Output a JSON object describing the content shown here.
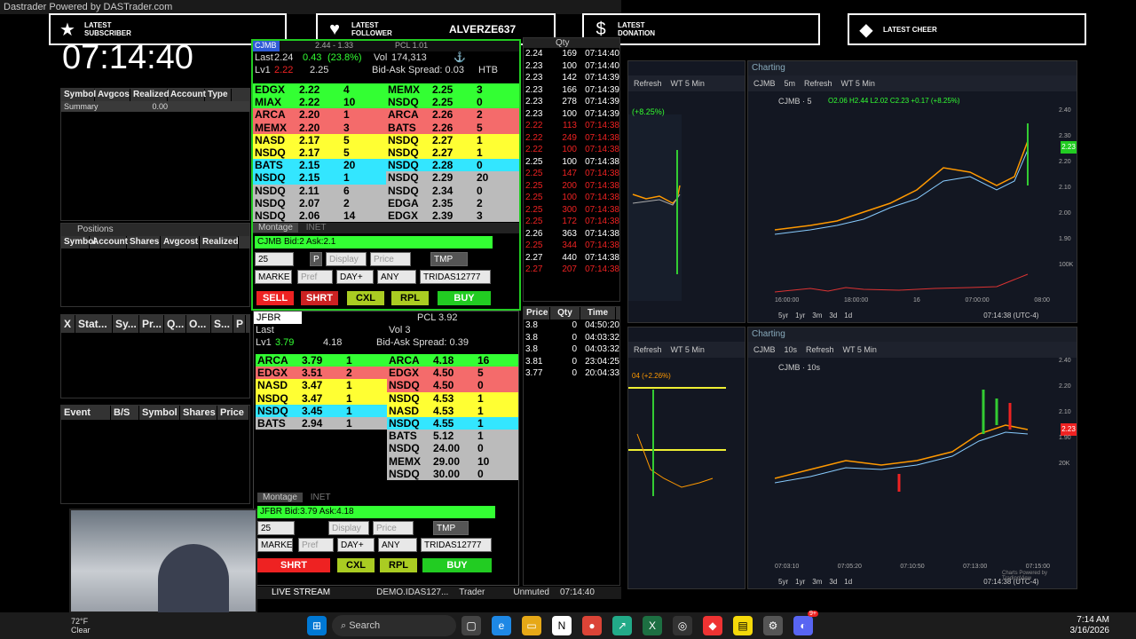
{
  "app_title": "Dastrader Powered by DASTrader.com",
  "clock": "07:14:40",
  "banners": [
    {
      "icon": "★",
      "label": "LATEST SUBSCRIBER",
      "value": ""
    },
    {
      "icon": "♥",
      "label": "LATEST FOLLOWER",
      "value": "ALVERZE637"
    },
    {
      "icon": "$",
      "label": "LATEST DONATION",
      "value": ""
    },
    {
      "icon": "◆",
      "label": "LATEST CHEER",
      "value": ""
    }
  ],
  "account_panel": {
    "columns": [
      "Symbol",
      "Avgcos",
      "Realized",
      "Account",
      "Type"
    ],
    "row": {
      "symbol": "Summary",
      "realized": "0.00"
    }
  },
  "positions_panel": {
    "title": "Positions",
    "columns": [
      "Symbol",
      "Account",
      "Shares",
      "Avgcost",
      "Realized"
    ]
  },
  "orders_panel": {
    "columns": [
      "X",
      "Stat...",
      "Sy...",
      "Pr...",
      "Q...",
      "O...",
      "S...",
      "P"
    ]
  },
  "trades_panel": {
    "columns": [
      "Event",
      "B/S",
      "Symbol",
      "Shares",
      "Price"
    ]
  },
  "montage1": {
    "symbol": "CJMB",
    "change_line": "2.44 - 1.33",
    "pcl": "PCL 1.01",
    "last": "2.24",
    "chg": "0.43",
    "chg_pct": "(23.8%)",
    "vol": "174,313",
    "htb": "HTB",
    "lv1_bid": "2.22",
    "lv1_ask": "2.25",
    "spread": "Bid-Ask Spread: 0.03",
    "bids": [
      {
        "ex": "EDGX",
        "px": "2.22",
        "sz": "4",
        "c": "green"
      },
      {
        "ex": "MIAX",
        "px": "2.22",
        "sz": "10",
        "c": "green"
      },
      {
        "ex": "ARCA",
        "px": "2.20",
        "sz": "1",
        "c": "red"
      },
      {
        "ex": "MEMX",
        "px": "2.20",
        "sz": "3",
        "c": "red"
      },
      {
        "ex": "NASD",
        "px": "2.17",
        "sz": "5",
        "c": "yellow"
      },
      {
        "ex": "NSDQ",
        "px": "2.17",
        "sz": "5",
        "c": "yellow"
      },
      {
        "ex": "BATS",
        "px": "2.15",
        "sz": "20",
        "c": "cyan"
      },
      {
        "ex": "NSDQ",
        "px": "2.15",
        "sz": "1",
        "c": "cyan"
      },
      {
        "ex": "NSDQ",
        "px": "2.11",
        "sz": "6",
        "c": "gray"
      },
      {
        "ex": "NSDQ",
        "px": "2.07",
        "sz": "2",
        "c": "gray"
      },
      {
        "ex": "NSDQ",
        "px": "2.06",
        "sz": "14",
        "c": "gray"
      }
    ],
    "asks": [
      {
        "ex": "MEMX",
        "px": "2.25",
        "sz": "3",
        "c": "green"
      },
      {
        "ex": "NSDQ",
        "px": "2.25",
        "sz": "0",
        "c": "green"
      },
      {
        "ex": "ARCA",
        "px": "2.26",
        "sz": "2",
        "c": "red"
      },
      {
        "ex": "BATS",
        "px": "2.26",
        "sz": "5",
        "c": "red"
      },
      {
        "ex": "NSDQ",
        "px": "2.27",
        "sz": "1",
        "c": "yellow"
      },
      {
        "ex": "NSDQ",
        "px": "2.27",
        "sz": "1",
        "c": "yellow"
      },
      {
        "ex": "NSDQ",
        "px": "2.28",
        "sz": "0",
        "c": "cyan"
      },
      {
        "ex": "NSDQ",
        "px": "2.29",
        "sz": "20",
        "c": "gray"
      },
      {
        "ex": "NSDQ",
        "px": "2.34",
        "sz": "0",
        "c": "gray"
      },
      {
        "ex": "EDGA",
        "px": "2.35",
        "sz": "2",
        "c": "gray"
      },
      {
        "ex": "EDGX",
        "px": "2.39",
        "sz": "3",
        "c": "gray"
      }
    ],
    "tab": "Montage",
    "tab2": "INET",
    "quote": "CJMB Bid:2 Ask:2.1",
    "qty": "25",
    "p": "P",
    "display": "Display",
    "price": "Price",
    "tmp": "TMP",
    "market": "MARKE",
    "pref": "Pref",
    "tif": "DAY+",
    "any": "ANY",
    "route": "TRIDAS12777",
    "buttons": {
      "sell": "SELL",
      "shrt": "SHRT",
      "cxl": "CXL",
      "rpl": "RPL",
      "buy": "BUY"
    }
  },
  "ts1": {
    "header_qty": "Qty",
    "rows": [
      {
        "p": "2.24",
        "q": "169",
        "t": "07:14:40",
        "c": "#fff"
      },
      {
        "p": "2.23",
        "q": "100",
        "t": "07:14:40",
        "c": "#fff"
      },
      {
        "p": "2.23",
        "q": "142",
        "t": "07:14:39",
        "c": "#fff"
      },
      {
        "p": "2.23",
        "q": "166",
        "t": "07:14:39",
        "c": "#fff"
      },
      {
        "p": "2.23",
        "q": "278",
        "t": "07:14:39",
        "c": "#fff"
      },
      {
        "p": "2.23",
        "q": "100",
        "t": "07:14:39",
        "c": "#fff"
      },
      {
        "p": "2.22",
        "q": "113",
        "t": "07:14:38",
        "c": "#e22"
      },
      {
        "p": "2.22",
        "q": "249",
        "t": "07:14:38",
        "c": "#e22"
      },
      {
        "p": "2.22",
        "q": "100",
        "t": "07:14:38",
        "c": "#e22"
      },
      {
        "p": "2.25",
        "q": "100",
        "t": "07:14:38",
        "c": "#fff"
      },
      {
        "p": "2.25",
        "q": "147",
        "t": "07:14:38",
        "c": "#e22"
      },
      {
        "p": "2.25",
        "q": "200",
        "t": "07:14:38",
        "c": "#e22"
      },
      {
        "p": "2.25",
        "q": "100",
        "t": "07:14:38",
        "c": "#e22"
      },
      {
        "p": "2.25",
        "q": "300",
        "t": "07:14:38",
        "c": "#e22"
      },
      {
        "p": "2.25",
        "q": "172",
        "t": "07:14:38",
        "c": "#e22"
      },
      {
        "p": "2.26",
        "q": "363",
        "t": "07:14:38",
        "c": "#fff"
      },
      {
        "p": "2.25",
        "q": "344",
        "t": "07:14:38",
        "c": "#e22"
      },
      {
        "p": "2.27",
        "q": "440",
        "t": "07:14:38",
        "c": "#fff"
      },
      {
        "p": "2.27",
        "q": "207",
        "t": "07:14:38",
        "c": "#e22"
      }
    ]
  },
  "montage2": {
    "symbol": "JFBR",
    "pcl": "PCL 3.92",
    "last": "Last",
    "vol": "Vol 3",
    "lv1_bid": "3.79",
    "lv1_ask": "4.18",
    "spread": "Bid-Ask Spread: 0.39",
    "bids": [
      {
        "ex": "ARCA",
        "px": "3.79",
        "sz": "1",
        "c": "green"
      },
      {
        "ex": "EDGX",
        "px": "3.51",
        "sz": "2",
        "c": "red"
      },
      {
        "ex": "NASD",
        "px": "3.47",
        "sz": "1",
        "c": "yellow"
      },
      {
        "ex": "NSDQ",
        "px": "3.47",
        "sz": "1",
        "c": "yellow"
      },
      {
        "ex": "NSDQ",
        "px": "3.45",
        "sz": "1",
        "c": "cyan"
      },
      {
        "ex": "BATS",
        "px": "2.94",
        "sz": "1",
        "c": "gray"
      }
    ],
    "asks": [
      {
        "ex": "ARCA",
        "px": "4.18",
        "sz": "16",
        "c": "green"
      },
      {
        "ex": "EDGX",
        "px": "4.50",
        "sz": "5",
        "c": "red"
      },
      {
        "ex": "NSDQ",
        "px": "4.50",
        "sz": "0",
        "c": "red"
      },
      {
        "ex": "NSDQ",
        "px": "4.53",
        "sz": "1",
        "c": "yellow"
      },
      {
        "ex": "NASD",
        "px": "4.53",
        "sz": "1",
        "c": "yellow"
      },
      {
        "ex": "NSDQ",
        "px": "4.55",
        "sz": "1",
        "c": "cyan"
      },
      {
        "ex": "BATS",
        "px": "5.12",
        "sz": "1",
        "c": "gray"
      },
      {
        "ex": "NSDQ",
        "px": "24.00",
        "sz": "0",
        "c": "gray"
      },
      {
        "ex": "MEMX",
        "px": "29.00",
        "sz": "10",
        "c": "gray"
      },
      {
        "ex": "NSDQ",
        "px": "30.00",
        "sz": "0",
        "c": "gray"
      }
    ],
    "tab": "Montage",
    "tab2": "INET",
    "quote": "JFBR Bid:3.79 Ask:4.18",
    "qty": "25",
    "display": "Display",
    "price": "Price",
    "tmp": "TMP",
    "market": "MARKE",
    "pref": "Pref",
    "tif": "DAY+",
    "any": "ANY",
    "route": "TRIDAS12777",
    "buttons": {
      "shrt": "SHRT",
      "cxl": "CXL",
      "rpl": "RPL",
      "buy": "BUY"
    }
  },
  "ts2": {
    "headers": [
      "Price",
      "Qty",
      "Time"
    ],
    "rows": [
      {
        "p": "3.8",
        "q": "0",
        "t": "04:50:20"
      },
      {
        "p": "3.8",
        "q": "0",
        "t": "04:03:32"
      },
      {
        "p": "3.8",
        "q": "0",
        "t": "04:03:32"
      },
      {
        "p": "3.81",
        "q": "0",
        "t": "23:04:25"
      },
      {
        "p": "3.77",
        "q": "0",
        "t": "20:04:33"
      }
    ]
  },
  "statusbar": {
    "live": "LIVE STREAM",
    "account": "DEMO.IDAS127...",
    "role": "Trader",
    "unmuted": "Unmuted",
    "time": "07:14:40"
  },
  "charts": {
    "title": "Charting",
    "refresh": "Refresh",
    "wt": "WT 5 Min",
    "c1": {
      "sym": "CJMB",
      "interval": "5m",
      "ohlc": "O2.06 H2.44 L2.02 C2.23 +0.17 (+8.25%)",
      "label": "CJMB · 5",
      "tag": "2.23",
      "left_pct": "(+8.25%)",
      "left_levels": [
        "2.40",
        "2.30",
        "2.20",
        "2.10",
        "2.00",
        "1.90"
      ],
      "right_levels": [
        "2.40",
        "2.30",
        "2.20",
        "2.10",
        "2.00",
        "1.90",
        "100K"
      ],
      "xlabels": [
        "16:00:00",
        "18:00:00",
        "16",
        "07:00:00",
        "08:00"
      ],
      "left_xlabels": [
        "07:00:00",
        "08:0"
      ]
    },
    "c2": {
      "sym": "CJMB",
      "interval": "10s",
      "label": "CJMB · 10s",
      "tag": "2.23",
      "left_pct": "04 (+2.26%)",
      "left_levels": [
        "6.00",
        "5.61",
        "5.00",
        "4.00",
        "3.13",
        "3.00",
        "2.00",
        "1.00",
        "200M",
        "100M"
      ],
      "right_levels": [
        "2.40",
        "2.20",
        "2.10",
        "1.90",
        "20K"
      ],
      "xlabels": [
        "07:03:10",
        "07:05:20",
        "07:10:50",
        "07:13:00",
        "07:15:00"
      ],
      "left_xlabels": [
        "2026",
        "Mar"
      ]
    },
    "footer": {
      "ranges": [
        "5yr",
        "1yr",
        "3m",
        "3d",
        "1d"
      ],
      "time": "07:14:38 (UTC-4)",
      "pct": "%",
      "log": "log",
      "auto": "auto"
    },
    "poweredby": "Charts Powered by TradingView"
  },
  "weather": {
    "temp": "72°F",
    "cond": "Clear"
  },
  "taskbar": {
    "search": "Search",
    "time": "7:14 AM",
    "date": "3/16/2026",
    "badge": "9+"
  },
  "colors": {
    "green": "#33ff33",
    "red": "#f46b6b",
    "yellow": "#ffff33",
    "cyan": "#33e6ff",
    "gray": "#bbbbbb",
    "tv_bg": "#131722"
  }
}
